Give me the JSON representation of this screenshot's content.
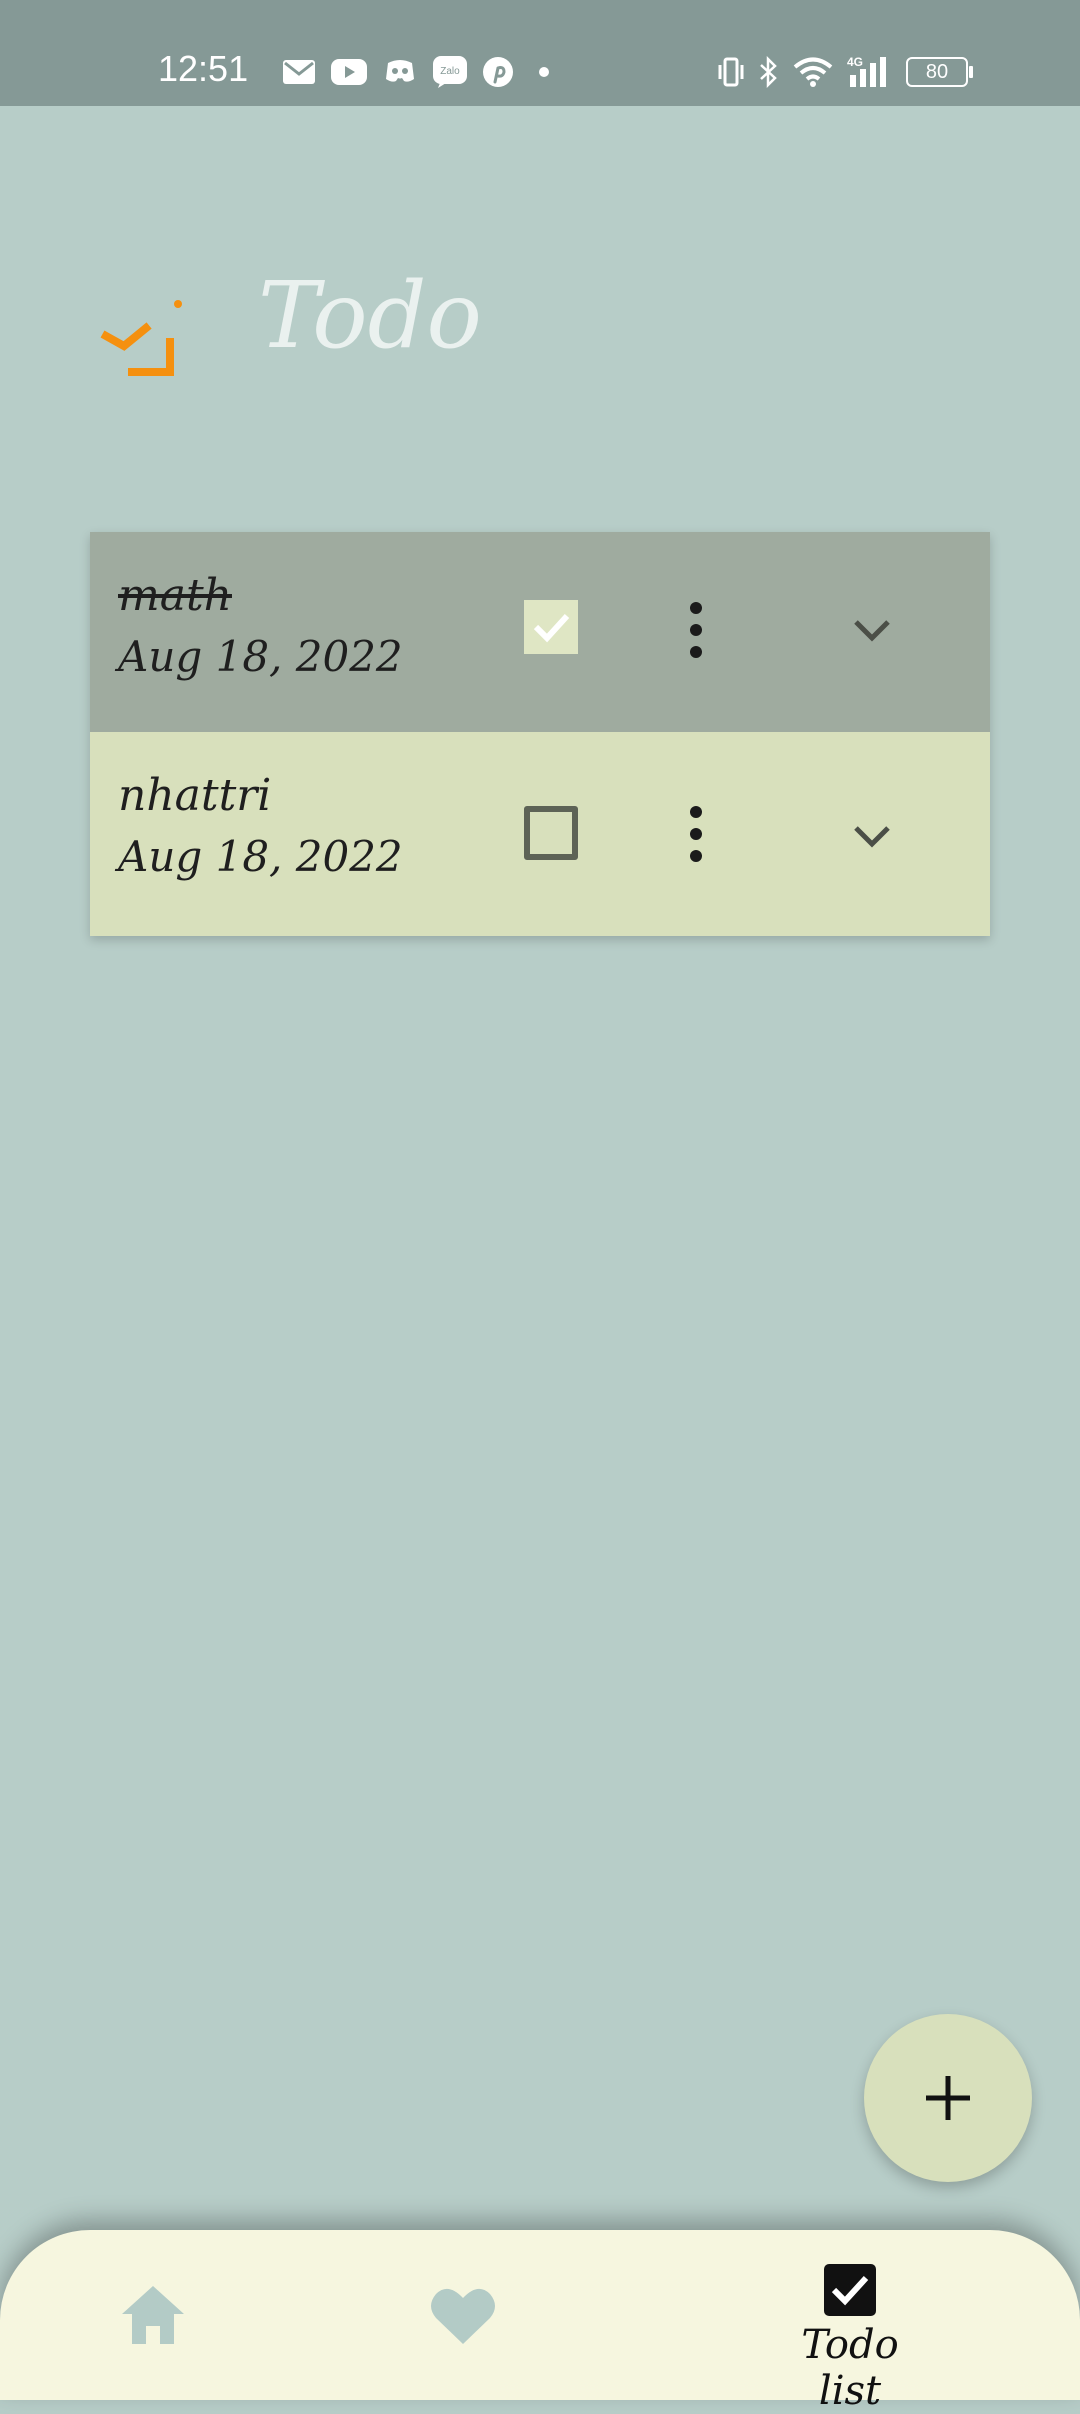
{
  "status_bar": {
    "time": "12:51",
    "battery": "80",
    "network": "4G",
    "left_icons": [
      "mail-icon",
      "youtube-icon",
      "discord-icon",
      "zalo-icon",
      "pinterest-icon",
      "dot-icon"
    ],
    "right_icons": [
      "vibrate-icon",
      "bluetooth-icon",
      "wifi-icon",
      "signal-icon",
      "battery-icon"
    ]
  },
  "header": {
    "title": "Todo",
    "logo_icon": "todo-logo-icon",
    "logo_color": "#f5900f"
  },
  "todos": [
    {
      "title": "math",
      "date": "Aug 18, 2022",
      "checked": true
    },
    {
      "title": "nhattri",
      "date": "Aug 18, 2022",
      "checked": false
    }
  ],
  "fab": {
    "icon": "plus-icon"
  },
  "bottom_nav": {
    "items": [
      {
        "icon": "home-icon",
        "label": "",
        "active": false
      },
      {
        "icon": "heart-icon",
        "label": "",
        "active": false
      },
      {
        "icon": "checkbox-icon",
        "label": "Todo list",
        "active": true
      }
    ]
  },
  "colors": {
    "background": "#b7cdc8",
    "status_bar": "#859996",
    "done_item": "#9fab9f",
    "pending_item": "#d8e0bc",
    "nav_bar": "#f6f6df",
    "inactive_nav_icon": "#b3cbc6"
  }
}
